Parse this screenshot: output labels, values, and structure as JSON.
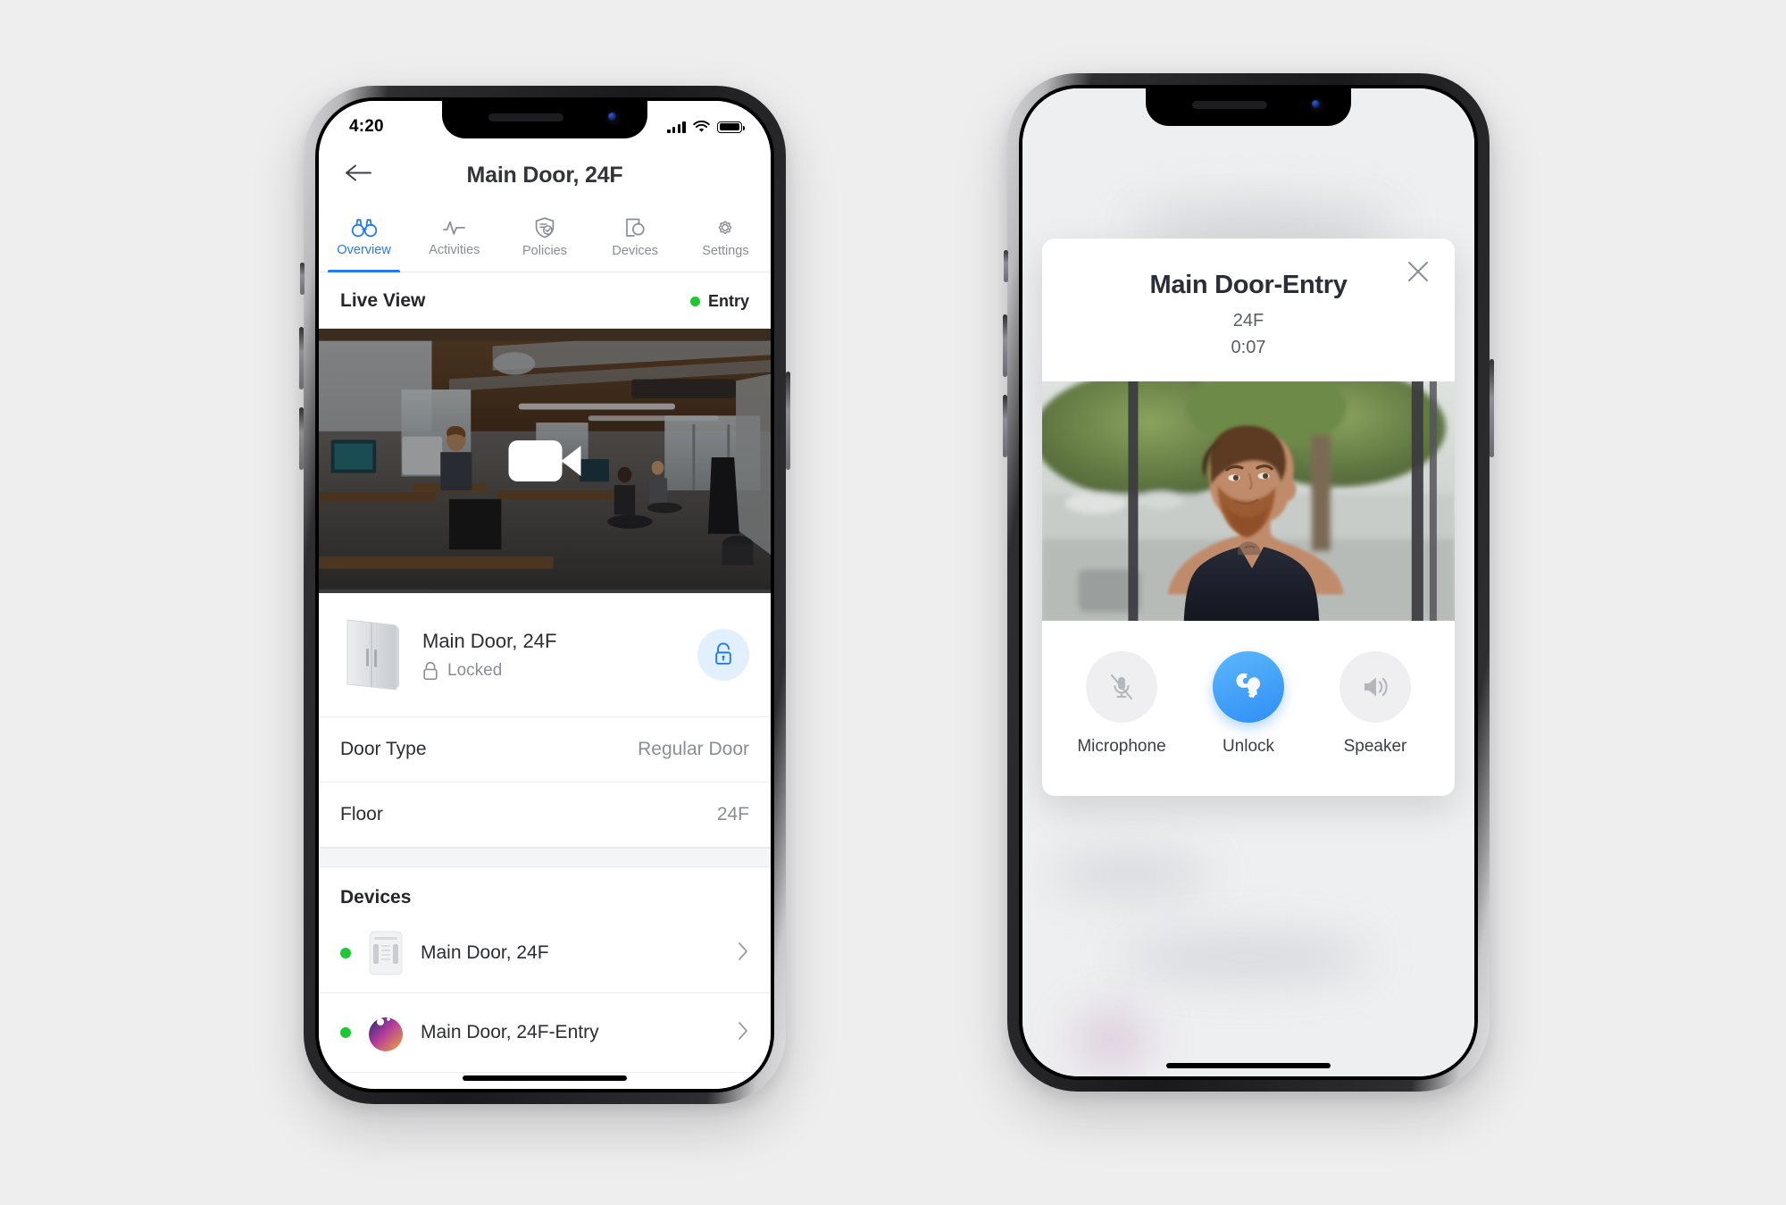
{
  "left_phone": {
    "status_bar": {
      "time": "4:20",
      "signal_icon": "cellular-bars-icon",
      "wifi_icon": "wifi-icon",
      "battery_icon": "battery-full-icon"
    },
    "nav": {
      "back_icon": "arrow-left-icon",
      "title": "Main Door, 24F"
    },
    "tabs": [
      {
        "label": "Overview",
        "icon": "binoculars-icon",
        "active": true
      },
      {
        "label": "Activities",
        "icon": "pulse-icon",
        "active": false
      },
      {
        "label": "Policies",
        "icon": "shield-check-icon",
        "active": false
      },
      {
        "label": "Devices",
        "icon": "device-icon",
        "active": false
      },
      {
        "label": "Settings",
        "icon": "gear-icon",
        "active": false
      }
    ],
    "live_view": {
      "title": "Live View",
      "status_label": "Entry",
      "status_color": "#1ec832",
      "play_icon": "video-play-icon"
    },
    "door_card": {
      "thumb_icon": "double-door-icon",
      "name": "Main Door, 24F",
      "lock_icon": "lock-closed-icon",
      "lock_state": "Locked",
      "action_icon": "unlock-icon",
      "action_color": "#2479f5"
    },
    "details": [
      {
        "key": "Door Type",
        "value": "Regular Door"
      },
      {
        "key": "Floor",
        "value": "24F"
      }
    ],
    "devices_section": {
      "title": "Devices",
      "items": [
        {
          "name": "Main Door, 24F",
          "status_color": "#1ec832",
          "thumb_icon": "access-controller-icon",
          "chevron_icon": "chevron-right-icon"
        },
        {
          "name": "Main Door, 24F-Entry",
          "status_color": "#1ec832",
          "thumb_icon": "intercom-camera-icon",
          "chevron_icon": "chevron-right-icon"
        }
      ]
    }
  },
  "right_phone": {
    "modal": {
      "close_icon": "close-icon",
      "title": "Main Door-Entry",
      "subtitle": "24F",
      "timer": "0:07",
      "video_alt": "intercom-video-feed",
      "actions": [
        {
          "label": "Microphone",
          "icon": "microphone-muted-icon",
          "primary": false
        },
        {
          "label": "Unlock",
          "icon": "keys-icon",
          "primary": true
        },
        {
          "label": "Speaker",
          "icon": "speaker-icon",
          "primary": false
        }
      ]
    }
  },
  "theme": {
    "accent": "#2479f5",
    "accent_soft": "#e2effd",
    "status_green": "#1ec832",
    "text_dark": "#2b2d33",
    "text_muted": "#8b8d96",
    "page_bg": "#eeeeef"
  }
}
